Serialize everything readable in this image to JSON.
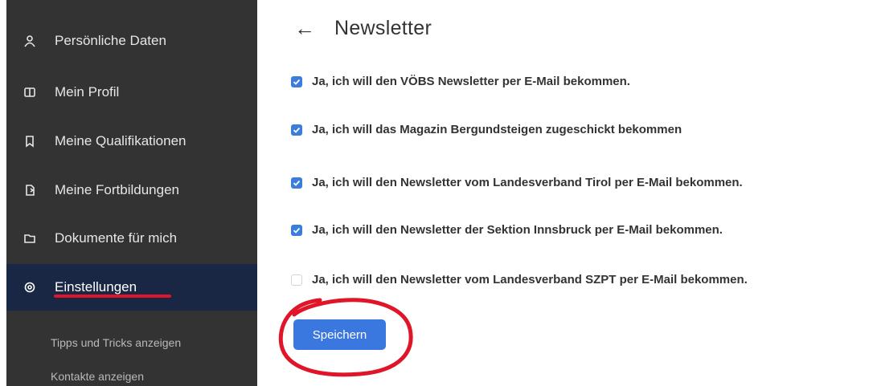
{
  "sidebar": {
    "items": [
      {
        "label": "Persönliche Daten",
        "icon": "user-icon"
      },
      {
        "label": "Mein Profil",
        "icon": "id-card-icon"
      },
      {
        "label": "Meine Qualifikationen",
        "icon": "bookmark-icon"
      },
      {
        "label": "Meine Fortbildungen",
        "icon": "document-icon"
      },
      {
        "label": "Dokumente für mich",
        "icon": "folder-icon"
      },
      {
        "label": "Einstellungen",
        "icon": "gear-icon",
        "active": true
      }
    ],
    "subitems": [
      {
        "label": "Tipps und Tricks anzeigen"
      },
      {
        "label": "Kontakte anzeigen"
      }
    ]
  },
  "main": {
    "title": "Newsletter",
    "back_icon": "arrow-left-icon",
    "options": [
      {
        "label": "Ja, ich will den VÖBS Newsletter per E-Mail bekommen.",
        "checked": true
      },
      {
        "label": "Ja, ich will das Magazin Bergundsteigen zugeschickt bekommen",
        "checked": true
      },
      {
        "label": "Ja, ich will den Newsletter vom Landesverband Tirol per E-Mail bekommen.",
        "checked": true
      },
      {
        "label": "Ja, ich will den Newsletter der Sektion Innsbruck per E-Mail bekommen.",
        "checked": true
      },
      {
        "label": "Ja, ich will den Newsletter vom Landesverband SZPT per E-Mail bekommen.",
        "checked": false
      }
    ],
    "save_label": "Speichern"
  },
  "colors": {
    "sidebar_bg": "#333333",
    "active_bg": "#1a2744",
    "accent": "#3a78e0",
    "annotation_red": "#e0152a"
  }
}
